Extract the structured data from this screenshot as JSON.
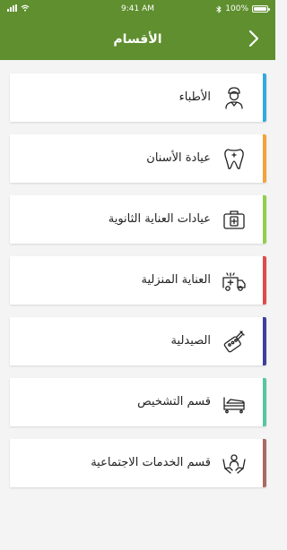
{
  "status_bar": {
    "time": "9:41 AM",
    "battery": "100%"
  },
  "header": {
    "title": "الأقسام",
    "back_icon": "chevron-right-icon",
    "background": "#5f8f2f"
  },
  "sections": [
    {
      "label": "الأطباء",
      "icon": "doctor-icon",
      "accent": "#34a9e0"
    },
    {
      "label": "عيادة الأسنان",
      "icon": "tooth-icon",
      "accent": "#f2a33a"
    },
    {
      "label": "عيادات العناية الثانوية",
      "icon": "first-aid-kit-icon",
      "accent": "#8fcf4a"
    },
    {
      "label": "العناية المنزلية",
      "icon": "ambulance-icon",
      "accent": "#e04a4a"
    },
    {
      "label": "الصيدلية",
      "icon": "syringe-pills-icon",
      "accent": "#3d3f9c"
    },
    {
      "label": "قسم التشخيص",
      "icon": "hospital-bed-icon",
      "accent": "#55c6a0"
    },
    {
      "label": "قسم الخدمات الاجتماعية",
      "icon": "helping-hands-icon",
      "accent": "#a86a64"
    }
  ]
}
